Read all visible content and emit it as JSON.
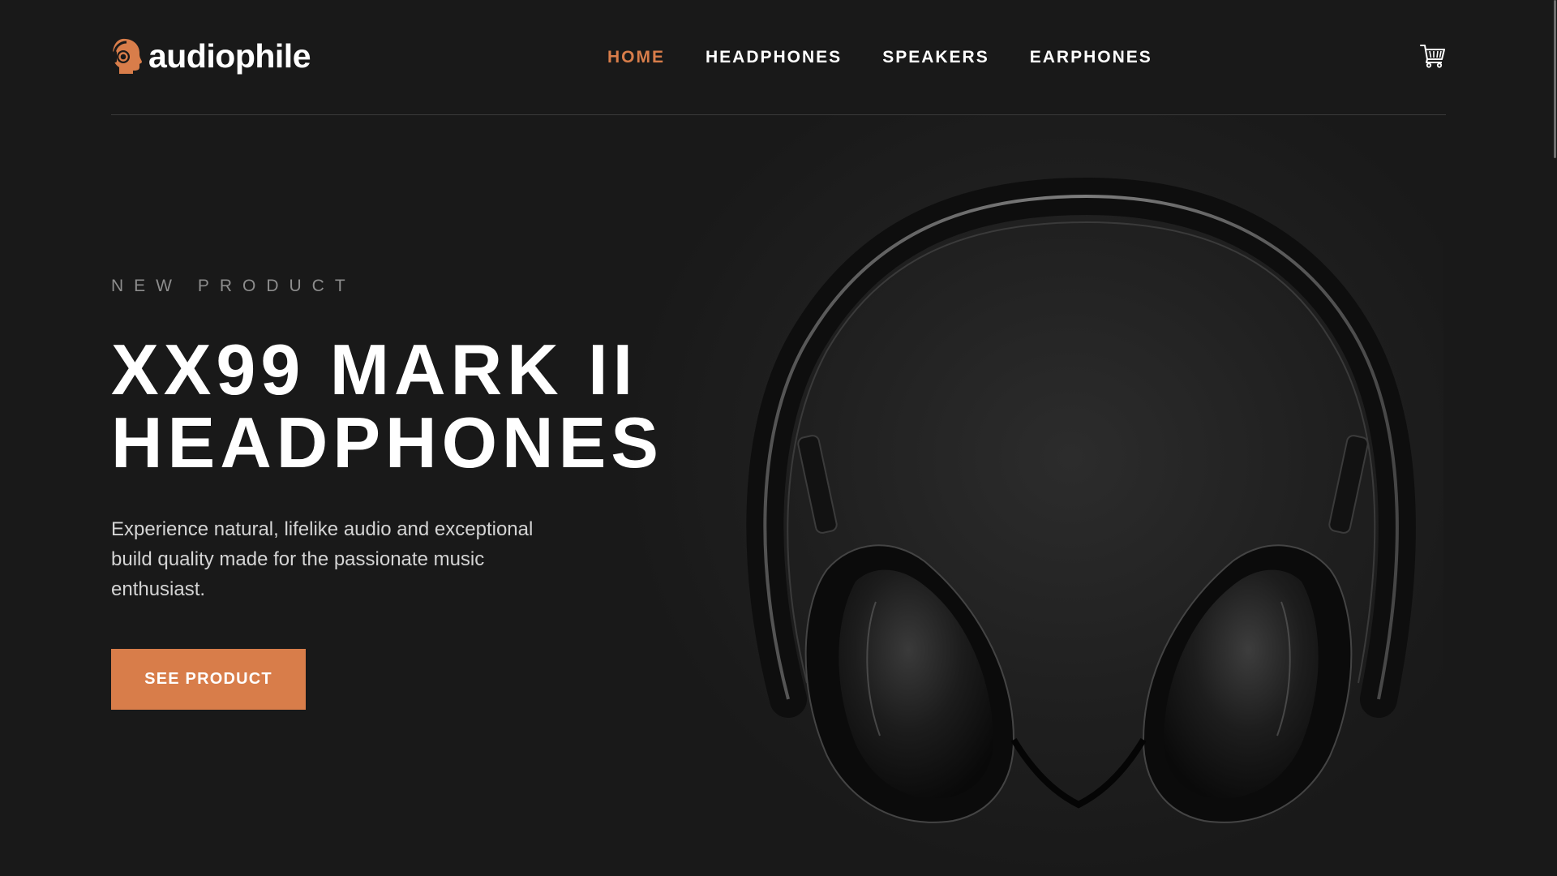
{
  "brand": {
    "name": "audiophile",
    "accent_color": "#d87d4a",
    "background_color": "#191919"
  },
  "nav": {
    "items": [
      {
        "label": "HOME",
        "active": true
      },
      {
        "label": "HEADPHONES",
        "active": false
      },
      {
        "label": "SPEAKERS",
        "active": false
      },
      {
        "label": "EARPHONES",
        "active": false
      }
    ],
    "cart_icon": "cart-icon"
  },
  "hero": {
    "overline": "NEW PRODUCT",
    "title_line1": "XX99 Mark II",
    "title_line2": "Headphones",
    "description": "Experience natural, lifelike audio and exceptional build quality made for the passionate music enthusiast.",
    "cta_label": "See Product",
    "image_icon": "headphones-image"
  }
}
